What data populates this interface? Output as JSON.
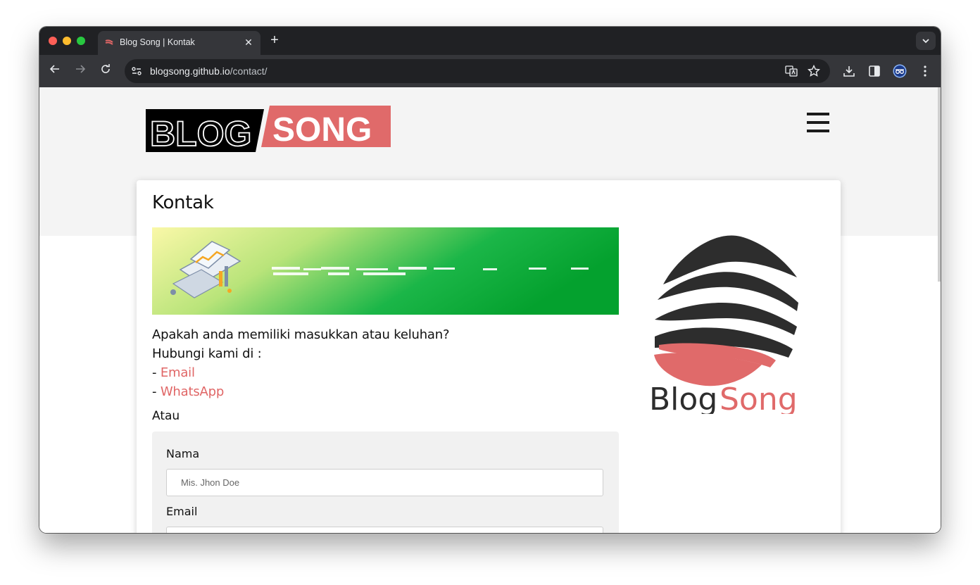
{
  "browser": {
    "tab_title": "Blog Song | Kontak",
    "new_tab_symbol": "+",
    "close_symbol": "✕",
    "url_domain": "blogsong.github.io",
    "url_path": "/contact/"
  },
  "site": {
    "logo_left": "BLOG",
    "logo_right": "SONG",
    "brand_left": "Blog",
    "brand_right": "Song",
    "accent_color": "#e06666",
    "dark_color": "#2d2d2d"
  },
  "page": {
    "title": "Kontak",
    "question": "Apakah anda memiliki masukkan atau keluhan?",
    "contact_intro": "Hubungi kami di :",
    "dash": "-",
    "link_email": "Email",
    "link_whatsapp": "WhatsApp",
    "atau": "Atau"
  },
  "form": {
    "name_label": "Nama",
    "name_placeholder": "Mis. Jhon Doe",
    "email_label": "Email",
    "email_placeholder": ""
  },
  "icons": [
    "back-icon",
    "forward-icon",
    "reload-icon",
    "site-info-icon",
    "translate-icon",
    "bookmark-star-icon",
    "download-icon",
    "side-panel-icon",
    "profile-icon",
    "menu-dots-icon",
    "hamburger-menu-icon",
    "tab-search-icon"
  ]
}
